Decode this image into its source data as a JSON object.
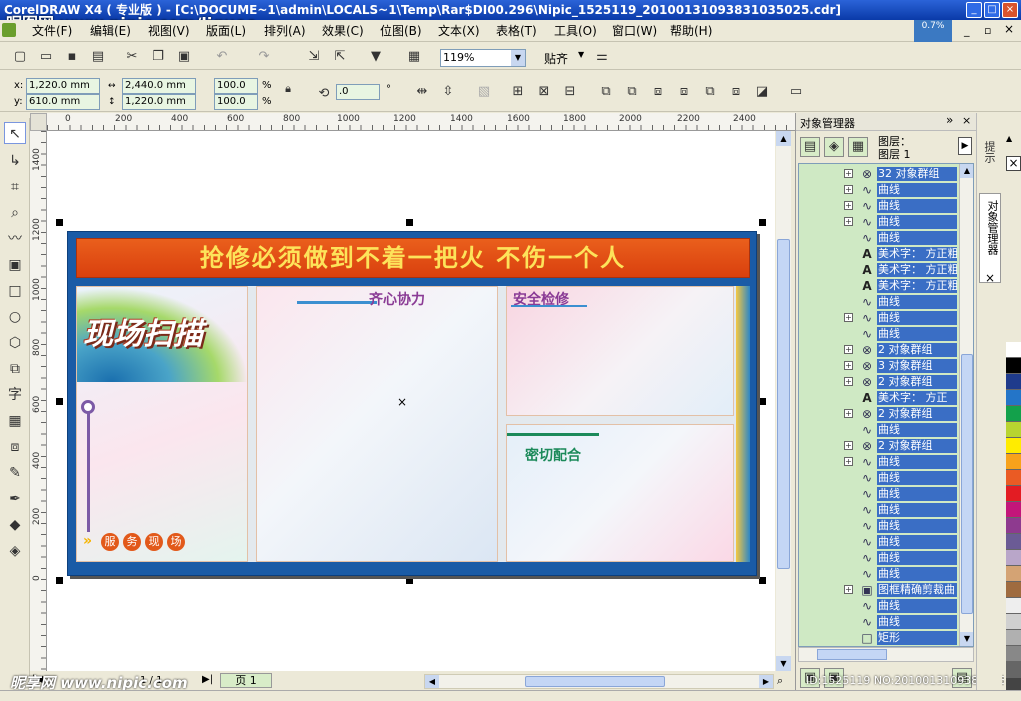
{
  "window": {
    "title": "CorelDRAW X4 ( 专业版 ) - [C:\\DOCUME~1\\admin\\LOCALS~1\\Temp\\Rar$DI00.296\\Nipic_1525119_20100131093831035025.cdr]",
    "progress": "0.7%",
    "watermark_top": "昵图网 www.nipic.com/liguoo"
  },
  "menu": [
    "文件(F)",
    "编辑(E)",
    "视图(V)",
    "版面(L)",
    "排列(A)",
    "效果(C)",
    "位图(B)",
    "文本(X)",
    "表格(T)",
    "工具(O)",
    "窗口(W)",
    "帮助(H)"
  ],
  "toolbar": {
    "zoom": "119%",
    "snap_label": "贴齐"
  },
  "propbar": {
    "x_label": "x:",
    "x_value": "1,220.0 mm",
    "y_label": "y:",
    "y_value": "610.0 mm",
    "w_value": "2,440.0 mm",
    "h_value": "1,220.0 mm",
    "sx_value": "100.0",
    "sy_value": "100.0",
    "pct": "%",
    "rotation": ".0",
    "deg": "°"
  },
  "ruler": {
    "h_ticks": [
      "0",
      "200",
      "400",
      "600",
      "800",
      "1000",
      "1200",
      "1400",
      "1600",
      "1800",
      "2000",
      "2200",
      "2400"
    ],
    "v_ticks": [
      "1400",
      "1200",
      "1000",
      "800",
      "600",
      "400",
      "200",
      "0"
    ]
  },
  "board": {
    "banner": "抢修必须做到不着一把火 不伤一个人",
    "logo": "现场扫描",
    "sec1": "齐心协力",
    "sec2": "安全检修",
    "sec3": "密切配合",
    "chips": [
      "服",
      "务",
      "现",
      "场"
    ]
  },
  "pagebar": {
    "page": "页 1",
    "nav": "1 / 1"
  },
  "docker": {
    "title": "对象管理器",
    "layer_label": "图层：",
    "layer_name": "图层 1",
    "rows": [
      {
        "exp": "+",
        "icon": "group-icon",
        "label": "32 对象群组"
      },
      {
        "exp": "+",
        "icon": "curve-icon",
        "label": "曲线"
      },
      {
        "exp": "+",
        "icon": "curve-icon",
        "label": "曲线"
      },
      {
        "exp": "+",
        "icon": "curve-icon",
        "label": "曲线"
      },
      {
        "exp": "",
        "icon": "curve-icon",
        "label": "曲线"
      },
      {
        "exp": "",
        "icon": "text-icon",
        "label": "美术字： 方正粗"
      },
      {
        "exp": "",
        "icon": "text-icon",
        "label": "美术字： 方正粗"
      },
      {
        "exp": "",
        "icon": "text-icon",
        "label": "美术字： 方正粗"
      },
      {
        "exp": "",
        "icon": "curve-icon",
        "label": "曲线"
      },
      {
        "exp": "+",
        "icon": "curve-icon",
        "label": "曲线"
      },
      {
        "exp": "",
        "icon": "curve-icon",
        "label": "曲线"
      },
      {
        "exp": "+",
        "icon": "group-icon",
        "label": "2 对象群组"
      },
      {
        "exp": "+",
        "icon": "group-icon",
        "label": "3 对象群组"
      },
      {
        "exp": "+",
        "icon": "group-icon",
        "label": "2 对象群组"
      },
      {
        "exp": "",
        "icon": "text-icon",
        "label": "美术字： 方正"
      },
      {
        "exp": "+",
        "icon": "group-icon",
        "label": "2 对象群组"
      },
      {
        "exp": "",
        "icon": "curve-icon",
        "label": "曲线"
      },
      {
        "exp": "+",
        "icon": "group-icon",
        "label": "2 对象群组"
      },
      {
        "exp": "+",
        "icon": "curve-icon",
        "label": "曲线"
      },
      {
        "exp": "",
        "icon": "curve-icon",
        "label": "曲线"
      },
      {
        "exp": "",
        "icon": "curve-icon",
        "label": "曲线"
      },
      {
        "exp": "",
        "icon": "curve-icon",
        "label": "曲线"
      },
      {
        "exp": "",
        "icon": "curve-icon",
        "label": "曲线"
      },
      {
        "exp": "",
        "icon": "curve-icon",
        "label": "曲线"
      },
      {
        "exp": "",
        "icon": "curve-icon",
        "label": "曲线"
      },
      {
        "exp": "",
        "icon": "curve-icon",
        "label": "曲线"
      },
      {
        "exp": "+",
        "icon": "powerclip-icon",
        "label": "图框精确剪裁曲"
      },
      {
        "exp": "",
        "icon": "curve-icon",
        "label": "曲线"
      },
      {
        "exp": "",
        "icon": "curve-icon",
        "label": "曲线"
      },
      {
        "exp": "",
        "icon": "rect-icon",
        "label": "矩形"
      }
    ]
  },
  "side_tabs": [
    "提示",
    "对象管理器"
  ],
  "watermark": {
    "bottom_left": "昵享网 www.nipic.com",
    "bottom_id": "ID:1525119 NO:20100131093831035025"
  },
  "palette": [
    "#ffffff",
    "#000000",
    "#1f3b8c",
    "#2475c8",
    "#13a14b",
    "#b8d430",
    "#ffec00",
    "#f7a21b",
    "#ea5b24",
    "#e31c23",
    "#c3167a",
    "#8e3a8f",
    "#6b5b95",
    "#b9a6c9",
    "#d4a374",
    "#9f6b3f",
    "#eeeeee",
    "#d0d0d0",
    "#b0b0b0",
    "#888888",
    "#666666",
    "#444444"
  ]
}
